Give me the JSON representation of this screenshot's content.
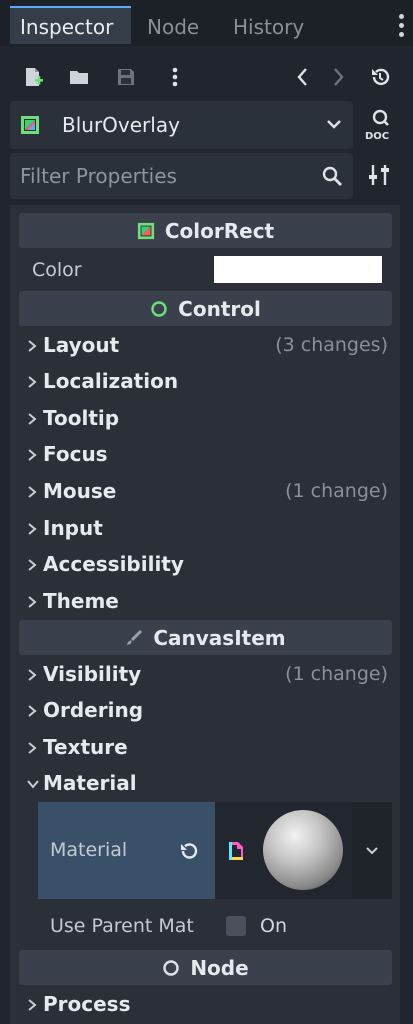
{
  "tabs": [
    "Inspector",
    "Node",
    "History"
  ],
  "object": {
    "name": "BlurOverlay"
  },
  "filter": {
    "placeholder": "Filter Properties"
  },
  "sections": {
    "colorrect": "ColorRect",
    "control": "Control",
    "canvasitem": "CanvasItem",
    "node": "Node"
  },
  "color_prop": {
    "label": "Color",
    "value": "#ffffff"
  },
  "control_groups": [
    {
      "label": "Layout",
      "note": "(3 changes)"
    },
    {
      "label": "Localization",
      "note": ""
    },
    {
      "label": "Tooltip",
      "note": ""
    },
    {
      "label": "Focus",
      "note": ""
    },
    {
      "label": "Mouse",
      "note": "(1 change)"
    },
    {
      "label": "Input",
      "note": ""
    },
    {
      "label": "Accessibility",
      "note": ""
    },
    {
      "label": "Theme",
      "note": ""
    }
  ],
  "canvas_groups": [
    {
      "label": "Visibility",
      "note": "(1 change)"
    },
    {
      "label": "Ordering",
      "note": ""
    },
    {
      "label": "Texture",
      "note": ""
    },
    {
      "label": "Material",
      "note": ""
    }
  ],
  "material": {
    "label": "Material"
  },
  "use_parent": {
    "label": "Use Parent Mat",
    "value": "On",
    "checked": false
  },
  "node_groups": [
    {
      "label": "Process",
      "note": ""
    }
  ],
  "colors": {
    "accent": "#5da9ff",
    "selected_row": "#3a4f68"
  }
}
